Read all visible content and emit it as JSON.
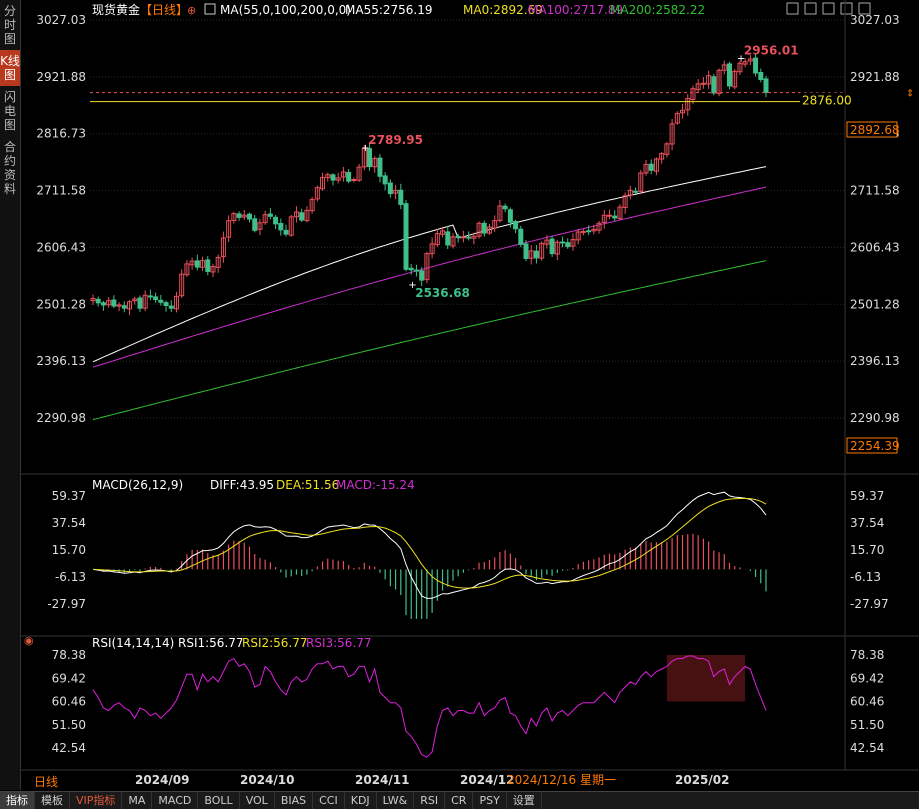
{
  "symbol": "现货黄金",
  "period_bracket": "【日线】",
  "left_tabs": [
    {
      "label": "分时图",
      "active": false
    },
    {
      "label": "K线图",
      "active": true
    },
    {
      "label": "闪电图",
      "active": false
    },
    {
      "label": "合约资料",
      "active": false
    }
  ],
  "main_header": {
    "ma_title": "MA(55,0,100,200,0,0)",
    "ma55": "MA55:2756.19",
    "ma0": "MA0:2892.69",
    "ma100": "MA100:2717.89",
    "ma200": "MA200:2582.22"
  },
  "window_icons": [
    "grid-icon",
    "add-window-icon",
    "minimize-icon",
    "restore-icon",
    "close-icon"
  ],
  "price_axis": [
    "3027.03",
    "2921.88",
    "2816.73",
    "2711.58",
    "2606.43",
    "2501.28",
    "2396.13",
    "2290.98"
  ],
  "price_tags": {
    "current": "2892.68",
    "reference": "2876.00",
    "low_edge": "2254.39"
  },
  "annotations": {
    "high1": "2789.95",
    "low1": "2536.68",
    "high2": "2956.01"
  },
  "macd_header": {
    "title": "MACD(26,12,9)",
    "diff": "DIFF:43.95",
    "dea": "DEA:51.56",
    "macd": "MACD:-15.24"
  },
  "macd_axis": [
    "59.37",
    "37.54",
    "15.70",
    "-6.13",
    "-27.97"
  ],
  "rsi_header": {
    "title": "RSI(14,14,14)",
    "rsi1": "RSI1:56.77",
    "rsi2": "RSI2:56.77",
    "rsi3": "RSI3:56.77"
  },
  "rsi_axis": [
    "78.38",
    "69.42",
    "60.46",
    "51.50",
    "42.54"
  ],
  "time_axis": {
    "period": "日线",
    "labels": [
      "2024/09",
      "2024/10",
      "2024/11",
      "2024/12",
      "2025/02"
    ],
    "cursor": "2024/12/16 星期一"
  },
  "bottom_tabs": [
    {
      "label": "指标",
      "active": true,
      "vip": false
    },
    {
      "label": "模板",
      "active": false,
      "vip": false
    },
    {
      "label": "VIP指标",
      "active": false,
      "vip": true
    },
    {
      "label": "MA",
      "active": false,
      "vip": false
    },
    {
      "label": "MACD",
      "active": false,
      "vip": false
    },
    {
      "label": "BOLL",
      "active": false,
      "vip": false
    },
    {
      "label": "VOL",
      "active": false,
      "vip": false
    },
    {
      "label": "BIAS",
      "active": false,
      "vip": false
    },
    {
      "label": "CCI",
      "active": false,
      "vip": false
    },
    {
      "label": "KDJ",
      "active": false,
      "vip": false
    },
    {
      "label": "LW&",
      "active": false,
      "vip": false
    },
    {
      "label": "RSI",
      "active": false,
      "vip": false
    },
    {
      "label": "CR",
      "active": false,
      "vip": false
    },
    {
      "label": "PSY",
      "active": false,
      "vip": false
    },
    {
      "label": "设置",
      "active": false,
      "vip": false
    }
  ],
  "colors": {
    "up": "#e8505b",
    "down": "#3fbf8a",
    "ma55": "#ffffff",
    "ma0": "#f0e020",
    "ma100": "#d030d0",
    "ma200": "#30c030",
    "diff": "#ffffff",
    "dea": "#f0e020",
    "rsi": "#e020e0",
    "accent": "#ff7a00"
  },
  "chart_data": [
    {
      "type": "candlestick",
      "title": "现货黄金 日线",
      "x_start": "2024/08/26",
      "x_end": "2025/02/25",
      "ylim": [
        2254.39,
        3027.03
      ],
      "key_points": [
        {
          "label": "2789.95",
          "value": 2789.95,
          "kind": "high"
        },
        {
          "label": "2536.68",
          "value": 2536.68,
          "kind": "low"
        },
        {
          "label": "2956.01",
          "value": 2956.01,
          "kind": "high"
        }
      ],
      "closes": [
        2512,
        2504,
        2500,
        2508,
        2498,
        2500,
        2494,
        2506,
        2511,
        2494,
        2518,
        2516,
        2510,
        2505,
        2499,
        2494,
        2516,
        2557,
        2576,
        2581,
        2570,
        2582,
        2562,
        2571,
        2588,
        2624,
        2656,
        2669,
        2662,
        2666,
        2659,
        2638,
        2652,
        2667,
        2664,
        2650,
        2639,
        2631,
        2663,
        2672,
        2657,
        2675,
        2695,
        2717,
        2736,
        2741,
        2731,
        2735,
        2746,
        2729,
        2732,
        2755,
        2789,
        2756,
        2771,
        2738,
        2724,
        2706,
        2712,
        2686,
        2566,
        2565,
        2563,
        2546,
        2595,
        2613,
        2632,
        2637,
        2611,
        2626,
        2625,
        2626,
        2624,
        2627,
        2651,
        2633,
        2644,
        2656,
        2683,
        2678,
        2653,
        2641,
        2612,
        2586,
        2600,
        2587,
        2614,
        2620,
        2595,
        2616,
        2616,
        2608,
        2621,
        2635,
        2636,
        2637,
        2640,
        2651,
        2666,
        2666,
        2661,
        2681,
        2702,
        2712,
        2710,
        2744,
        2760,
        2749,
        2770,
        2780,
        2798,
        2835,
        2854,
        2860,
        2882,
        2900,
        2909,
        2910,
        2924,
        2892,
        2934,
        2944,
        2905,
        2932,
        2947,
        2950,
        2955,
        2929,
        2917,
        2893
      ],
      "series": [
        {
          "name": "MA55",
          "value": 2756.19
        },
        {
          "name": "MA0",
          "value": 2892.69
        },
        {
          "name": "MA100",
          "value": 2717.89
        },
        {
          "name": "MA200",
          "value": 2582.22
        }
      ]
    },
    {
      "type": "bar",
      "title": "MACD(26,12,9)",
      "ylim": [
        -40,
        70
      ],
      "diff_last": 43.95,
      "dea_last": 51.56,
      "macd_last": -15.24
    },
    {
      "type": "line",
      "title": "RSI(14,14,14)",
      "ylim": [
        37,
        79
      ],
      "values": [
        65,
        62,
        58,
        57,
        59,
        60,
        58,
        57,
        54,
        58,
        57,
        55,
        56,
        54,
        56,
        58,
        61,
        66,
        71,
        71,
        65,
        71,
        68,
        70,
        68,
        72,
        76,
        77,
        74,
        75,
        72,
        66,
        67,
        74,
        72,
        68,
        65,
        63,
        68,
        70,
        68,
        69,
        73,
        75,
        75,
        76,
        73,
        74,
        74,
        70,
        71,
        74,
        74,
        68,
        73,
        64,
        62,
        60,
        60,
        58,
        49,
        47,
        44,
        40,
        39,
        41,
        51,
        57,
        58,
        55,
        57,
        57,
        56,
        56,
        60,
        55,
        57,
        58,
        61,
        62,
        56,
        55,
        51,
        48,
        54,
        51,
        56,
        58,
        53,
        56,
        57,
        55,
        57,
        59,
        60,
        60,
        60,
        62,
        64,
        62,
        60,
        64,
        66,
        68,
        67,
        70,
        72,
        70,
        72,
        73,
        74,
        76,
        77,
        77,
        78,
        78,
        77,
        77,
        76,
        70,
        72,
        73,
        67,
        70,
        72,
        74,
        73,
        67,
        62,
        57
      ]
    }
  ]
}
